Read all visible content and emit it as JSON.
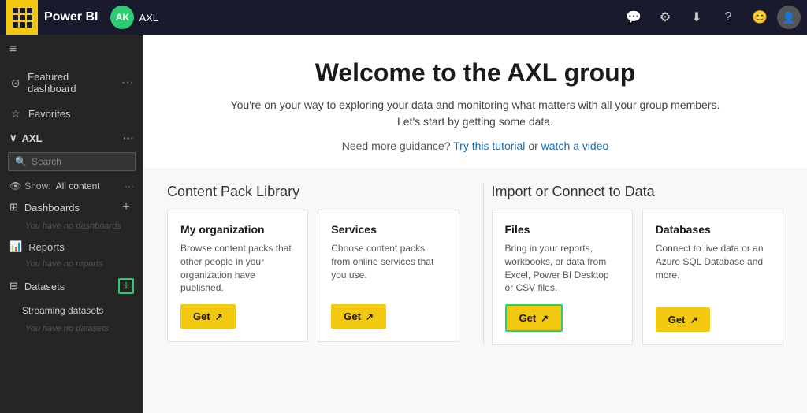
{
  "app": {
    "title": "Power BI",
    "username": "AXL",
    "avatar_initials": "AK"
  },
  "topbar": {
    "icons": [
      "💬",
      "⚙",
      "⬇",
      "?",
      "😊"
    ]
  },
  "sidebar": {
    "hamburger": "≡",
    "featured_dashboard": "Featured dashboard",
    "favorites": "Favorites",
    "axl_section": "AXL",
    "search_placeholder": "Search",
    "show_label": "Show:",
    "show_value": "All content",
    "dashboards": "Dashboards",
    "no_dashboards": "You have no dashboards",
    "reports": "Reports",
    "no_reports": "You have no reports",
    "datasets": "Datasets",
    "streaming_datasets": "Streaming datasets",
    "no_datasets": "You have no datasets"
  },
  "welcome": {
    "title": "Welcome to the AXL group",
    "subtitle_line1": "You're on your way to exploring your data and monitoring what matters with all your group members.",
    "subtitle_line2": "Let's start by getting some data.",
    "guidance_prefix": "Need more guidance?",
    "try_tutorial": "Try this tutorial",
    "or_text": "or",
    "watch_video": "watch a video"
  },
  "content_pack": {
    "section_title": "Content Pack Library",
    "cards": [
      {
        "title": "My organization",
        "desc": "Browse content packs that other people in your organization have published.",
        "btn_label": "Get"
      },
      {
        "title": "Services",
        "desc": "Choose content packs from online services that you use.",
        "btn_label": "Get"
      }
    ]
  },
  "import_connect": {
    "section_title": "Import or Connect to Data",
    "cards": [
      {
        "title": "Files",
        "desc": "Bring in your reports, workbooks, or data from Excel, Power BI Desktop or CSV files.",
        "btn_label": "Get",
        "highlighted": true
      },
      {
        "title": "Databases",
        "desc": "Connect to live data or an Azure SQL Database and more.",
        "btn_label": "Get",
        "highlighted": false
      }
    ]
  }
}
